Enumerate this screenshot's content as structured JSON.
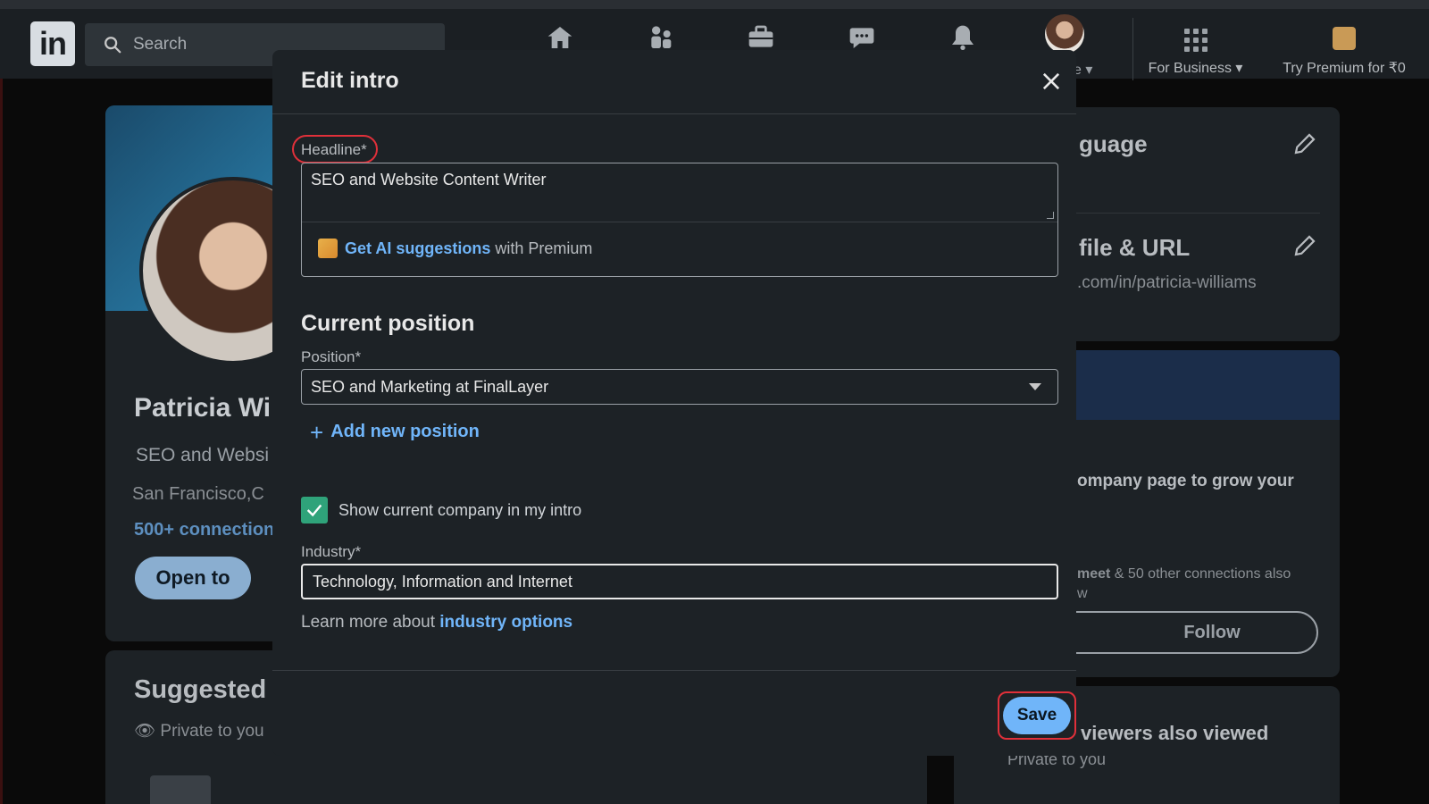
{
  "topnav": {
    "search_placeholder": "Search",
    "me_caret": "e ▾",
    "for_business": "For Business ▾",
    "premium": "Try Premium for ₹0"
  },
  "profile": {
    "name": "Patricia Wi",
    "headline": "SEO and Websi",
    "location": "San Francisco,C",
    "connections": "500+ connection",
    "open_to": "Open to"
  },
  "suggested": {
    "title": "Suggested f",
    "subtitle": "Private to you"
  },
  "right": {
    "language": "guage",
    "profile_url_title": "file & URL",
    "profile_url": ".com/in/patricia-williams",
    "company_text": "ompany page to grow your",
    "connections_note_bold": "meet",
    "connections_note": " & 50 other connections also",
    "connections_note2": "w",
    "follow_label": "Follow",
    "viewers_title": "viewers also viewed",
    "viewers_sub": "Private to you"
  },
  "modal": {
    "title": "Edit intro",
    "headline_label": "Headline*",
    "headline_value": "SEO and Website Content Writer",
    "ai_link": "Get AI suggestions",
    "ai_suffix": " with Premium",
    "section_title": "Current position",
    "position_label": "Position*",
    "position_value": "SEO and Marketing at FinalLayer",
    "add_position": "Add new position",
    "show_company_label": "Show current company in my intro",
    "industry_label": "Industry*",
    "industry_value": "Technology, Information and Internet",
    "learn_prefix": "Learn more about ",
    "learn_link": "industry options",
    "save_label": "Save"
  },
  "colors": {
    "accent_link": "#70b5f9",
    "highlight_ring": "#e0303a",
    "checkbox": "#2fa37a",
    "modal_bg": "#1d2226"
  }
}
